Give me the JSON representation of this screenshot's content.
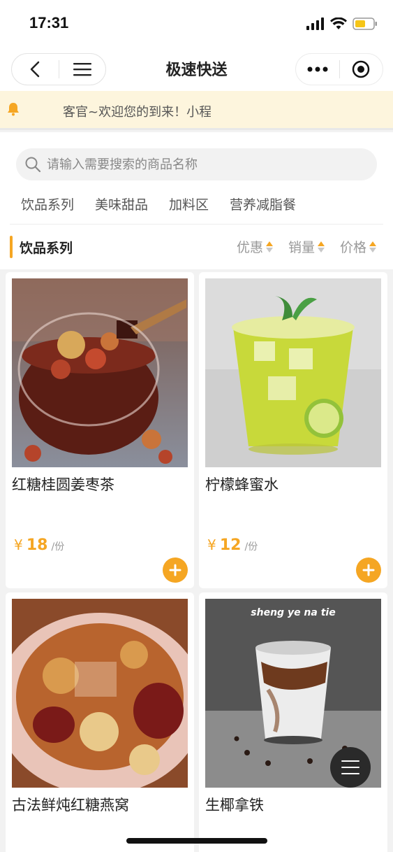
{
  "status_bar": {
    "time": "17:31"
  },
  "nav": {
    "title": "极速快送"
  },
  "notice": {
    "text": "客官~欢迎您的到来！小程序"
  },
  "search": {
    "placeholder": "请输入需要搜索的商品名称"
  },
  "categories": [
    "饮品系列",
    "美味甜品",
    "加料区",
    "营养减脂餐"
  ],
  "section": {
    "title": "饮品系列"
  },
  "sort": {
    "discount": "优惠",
    "sales": "销量",
    "price": "价格"
  },
  "products": [
    {
      "name": "红糖桂圆姜枣茶",
      "currency": "¥",
      "price": "18",
      "unit": "/份"
    },
    {
      "name": "柠檬蜂蜜水",
      "currency": "¥",
      "price": "12",
      "unit": "/份"
    },
    {
      "name": "古法鲜炖红糖燕窝"
    },
    {
      "name": "生椰拿铁",
      "image_caption": "sheng ye na tie"
    }
  ],
  "colors": {
    "accent": "#f5a623",
    "notice_bg": "#fdf5dd",
    "page_bg": "#f2f2f2"
  },
  "icons": [
    "back-icon",
    "menu-icon",
    "more-icon",
    "target-icon",
    "bell-icon",
    "search-icon",
    "plus-icon",
    "hamburger-icon"
  ]
}
